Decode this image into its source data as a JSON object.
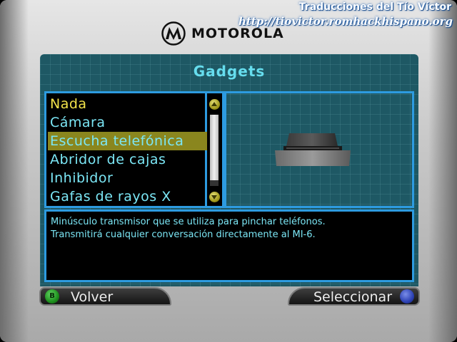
{
  "credits": {
    "title": "Traducciones del Tío Víctor",
    "url": "http://tiovictor.romhackhispano.org"
  },
  "brand": {
    "name": "MOTOROLA"
  },
  "screen": {
    "title": "Gadgets",
    "items": [
      {
        "label": "Nada",
        "state": "current"
      },
      {
        "label": "Cámara",
        "state": "normal"
      },
      {
        "label": "Escucha telefónica",
        "state": "selected"
      },
      {
        "label": "Abridor de cajas",
        "state": "normal"
      },
      {
        "label": "Inhibidor",
        "state": "normal"
      },
      {
        "label": "Gafas de rayos X",
        "state": "normal"
      }
    ],
    "description": [
      "Minúsculo transmisor que se utiliza para pinchar teléfonos.",
      "Transmitirá cualquier conversación directamente al MI-6."
    ]
  },
  "softkeys": {
    "back_button": "B",
    "back_label": "Volver",
    "select_label": "Seleccionar"
  },
  "colors": {
    "text": "#7be6f5",
    "current_item": "#f2e24a",
    "selection_bg": "#8a861e",
    "frame": "#2d9be0",
    "screen_bg": "#1e5864",
    "title": "#66ddee"
  },
  "icons": {
    "logo": "motorola-batwing-icon",
    "preview": "phone-bug-gadget-icon",
    "back": "green-b-button-icon",
    "select": "blue-button-icon"
  }
}
